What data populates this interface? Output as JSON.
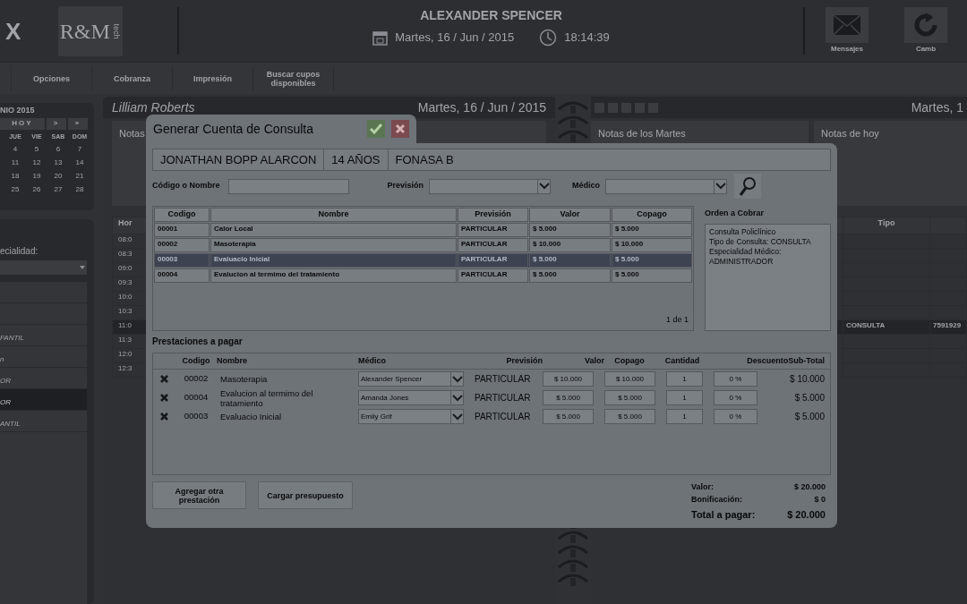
{
  "header": {
    "brand_mark": "X",
    "logo": "R&M",
    "logo_sub": "tech",
    "title": "ALEXANDER SPENCER",
    "date": "Martes, 16 / Jun / 2015",
    "time": "18:14:39",
    "actions": [
      {
        "label": "Mensajes",
        "kind": "mail"
      },
      {
        "label": "Camb",
        "kind": "refresh"
      }
    ]
  },
  "menu": [
    "Opciones",
    "Cobranza",
    "Impresión",
    "Buscar cupos disponibles"
  ],
  "mini_calendar": {
    "title": "NIO 2015",
    "nav": [
      "HOY",
      ">",
      "»"
    ],
    "weekdays": [
      "JUE",
      "VIE",
      "SAB",
      "DOM"
    ],
    "weeks": [
      [
        "4",
        "5",
        "6",
        "7"
      ],
      [
        "11",
        "12",
        "13",
        "14"
      ],
      [
        "18",
        "19",
        "20",
        "21"
      ],
      [
        "25",
        "26",
        "27",
        "28"
      ]
    ]
  },
  "specialty": {
    "label": "ecialidad:",
    "items": [
      {
        "text": "FANTIL",
        "selected": false
      },
      {
        "text": "n",
        "selected": false
      },
      {
        "text": "OR",
        "selected": false
      },
      {
        "text": "OR",
        "selected": true
      },
      {
        "text": "ANTIL",
        "selected": false
      }
    ]
  },
  "agenda": {
    "doctor": "Lilliam Roberts",
    "date": "Martes, 16 / Jun / 2015",
    "right_date": "Martes, 1",
    "notes": [
      "Notas",
      "Notas de los Martes",
      "Notas de hoy"
    ],
    "hour_column": "Hor",
    "type_column": "Tipo",
    "rows": [
      {
        "time": "08:0",
        "booked": false
      },
      {
        "time": "08:3",
        "booked": false
      },
      {
        "time": "09:0",
        "booked": false
      },
      {
        "time": "09:3",
        "booked": false
      },
      {
        "time": "10:0",
        "booked": false
      },
      {
        "time": "10:3",
        "booked": false
      },
      {
        "time": "11:0",
        "booked": true,
        "type": "CONSULTA",
        "column_3": "7591929"
      },
      {
        "time": "11:3",
        "booked": false
      },
      {
        "time": "12:0",
        "booked": false
      },
      {
        "time": "12:3",
        "booked": false
      }
    ]
  },
  "dialog": {
    "title": "Generar Cuenta de Consulta",
    "patient": [
      "JONATHAN BOPP ALARCON",
      "14 AÑOS",
      "FONASA B"
    ],
    "filters": [
      {
        "label": "Código o Nombre",
        "kind": "text"
      },
      {
        "label": "Previsión",
        "kind": "select"
      },
      {
        "label": "Médico",
        "kind": "select"
      }
    ],
    "catalog": {
      "columns": [
        "Codigo",
        "Nombre",
        "Previsión",
        "Valor",
        "Copago"
      ],
      "rows": [
        {
          "cells": [
            "00001",
            "Calor Local",
            "PARTICULAR",
            "$ 5.000",
            "$ 5.000"
          ],
          "selected": false
        },
        {
          "cells": [
            "00002",
            "Masoterapia",
            "PARTICULAR",
            "$ 10.000",
            "$ 10.000"
          ],
          "selected": false
        },
        {
          "cells": [
            "00003",
            "Evaluacio Inicial",
            "PARTICULAR",
            "$ 5.000",
            "$ 5.000"
          ],
          "selected": true
        },
        {
          "cells": [
            "00004",
            "Evalucion al termimo del tratamiento",
            "PARTICULAR",
            "$ 5.000",
            "$ 5.000"
          ],
          "selected": false
        }
      ],
      "pager": "1 de 1"
    },
    "order": {
      "title": "Orden a Cobrar",
      "lines": [
        "Consulta Policlínico",
        "Tipo de Consulta: CONSULTA",
        "Especialidad Médico:",
        "ADMINISTRADOR"
      ]
    },
    "items_title": "Prestaciones a pagar",
    "items": {
      "columns": [
        "Codigo",
        "Nombre",
        "Médico",
        "Previsión",
        "Valor",
        "Copago",
        "Cantidad",
        "Descuento",
        "Sub-Total"
      ],
      "rows": [
        {
          "code": "00002",
          "name": "Masoterapia",
          "doctor": "Alexander Spencer",
          "plan": "PARTICULAR",
          "value": "$ 10.000",
          "copay": "$ 10.000",
          "qty": "1",
          "discount": "0 %",
          "subtotal": "$ 10.000"
        },
        {
          "code": "00004",
          "name": "Evalucion al termimo del tratamiento",
          "doctor": "Amanda Jones",
          "plan": "PARTICULAR",
          "value": "$ 5.000",
          "copay": "$ 5.000",
          "qty": "1",
          "discount": "0 %",
          "subtotal": "$ 5.000"
        },
        {
          "code": "00003",
          "name": "Evaluacio Inicial",
          "doctor": "Emily Grif",
          "plan": "PARTICULAR",
          "value": "$ 5.000",
          "copay": "$ 5.000",
          "qty": "1",
          "discount": "0 %",
          "subtotal": "$ 5.000"
        }
      ]
    },
    "buttons": [
      "Agregar otra prestación",
      "Cargar presupuesto"
    ],
    "totals": [
      {
        "label": "Valor:",
        "value": "$ 20.000",
        "kind": "normal"
      },
      {
        "label": "Bonificación:",
        "value": "$ 0",
        "kind": "normal"
      },
      {
        "label": "Total a pagar:",
        "value": "$ 20.000",
        "kind": "grand"
      }
    ]
  }
}
